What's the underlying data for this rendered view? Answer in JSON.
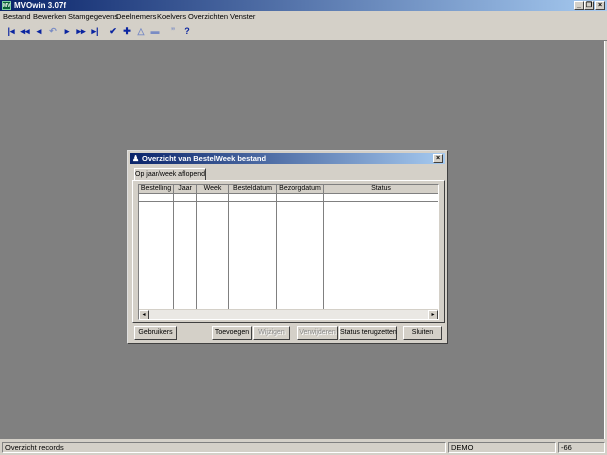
{
  "app": {
    "title": "MVOwin 3.07f",
    "icon_label": "MV"
  },
  "menu": [
    {
      "label": "Bestand"
    },
    {
      "label": "Bewerken"
    },
    {
      "label": "Stamgegevens"
    },
    {
      "label": "Deelnemers"
    },
    {
      "label": "Koelvers"
    },
    {
      "label": "Overzichten"
    },
    {
      "label": "Venster"
    }
  ],
  "toolbar": {
    "icons": [
      "first-record-icon",
      "previous-page-icon",
      "previous-record-icon",
      "refresh-icon",
      "next-record-icon",
      "next-page-icon",
      "last-record-icon",
      "confirm-check-icon",
      "add-plus-icon",
      "edit-triangle-icon",
      "delete-minus-icon",
      "quote-icon",
      "help-icon"
    ]
  },
  "dialog": {
    "title": "Overzicht van BestelWeek bestand",
    "tab_label": "Op jaar/week aflopend",
    "columns": [
      "Bestelling",
      "Jaar",
      "Week",
      "Besteldatum",
      "Bezorgdatum",
      "Status"
    ],
    "rows": [],
    "buttons": {
      "users": "Gebruikers",
      "add": "Toevoegen",
      "edit": "Wijzigen",
      "delete": "Verwijderen",
      "reset_status": "Status terugzetten",
      "close": "Sluiten"
    }
  },
  "status": {
    "text": "Overzicht records",
    "mode": "DEMO",
    "value": "-66"
  },
  "colors": {
    "title_start": "#0a246a",
    "title_end": "#a6caf0",
    "workspace": "#808080",
    "chrome": "#d4d0c8",
    "toolbar_icon": "#0a24a0"
  }
}
